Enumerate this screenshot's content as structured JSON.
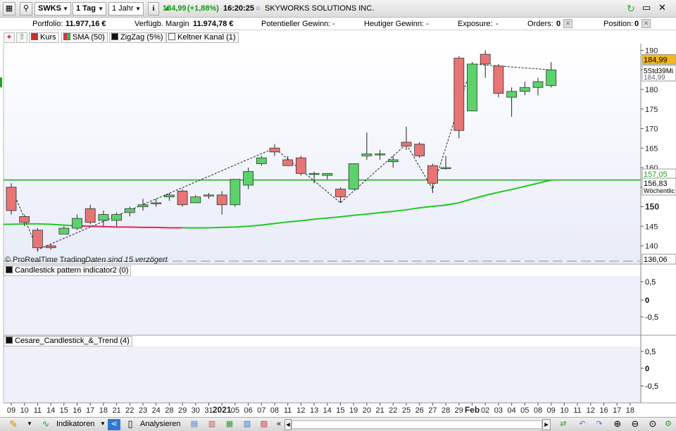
{
  "toolbar": {
    "symbol": "SWKS",
    "interval": "1 Tag",
    "range": "1 Jahr",
    "price": "184,99",
    "change": "(+1,88%)",
    "time": "16:20:25",
    "company": "SKYWORKS SOLUTIONS INC.",
    "info_icon": "info-icon"
  },
  "infobar": {
    "portfolio_label": "Portfolio:",
    "portfolio_value": "11.977,16 €",
    "margin_label": "Verfügb. Margin",
    "margin_value": "11.974,78 €",
    "pot_gain_label": "Potentieller Gewinn:",
    "pot_gain_value": "-",
    "today_gain_label": "Heutiger Gewinn:",
    "today_gain_value": "-",
    "exposure_label": "Exposure:",
    "exposure_value": "-",
    "orders_label": "Orders:",
    "orders_value": "0",
    "position_label": "Position:",
    "position_value": "0"
  },
  "indicators": {
    "kurs": "Kurs",
    "sma": "SMA (50)",
    "zigzag": "ZigZag (5%)",
    "keltner": "Keltner Kanal (1)"
  },
  "chart_labels": {
    "copyright": "© ProRealTime Trading",
    "delay": "Daten sind 15 verzögert",
    "price_tag": "184,99",
    "time_tag": "5Std39Mi",
    "hidden_tag": "184,99",
    "tag_157": "157,05",
    "tag_156": "156,83",
    "tag_weekly": "Wöchentlic",
    "tag_136": "136,06"
  },
  "panels": {
    "panel1_title": "Candlestick pattern indicator2 (0)",
    "panel2_title": "Cesare_Candlestick_&_Trend (4)",
    "p1_ticks": [
      "0,5",
      "0",
      "-0,5"
    ],
    "p2_ticks": [
      "0,5",
      "0",
      "-0,5"
    ]
  },
  "bottombar": {
    "indikatoren": "Indikatoren",
    "analysieren": "Analysieren"
  },
  "colors": {
    "up": "#5bd26a",
    "down": "#e77575",
    "sma_up": "#22c922",
    "sma_down": "#e8245a",
    "hline": "#1fa81f",
    "price_tag": "#f2b81c"
  },
  "chart_data": {
    "type": "candlestick",
    "y_ticks": [
      140,
      145,
      150,
      155,
      160,
      165,
      170,
      175,
      180,
      185,
      190
    ],
    "ylim": [
      136,
      192
    ],
    "x_labels": [
      "09",
      "10",
      "11",
      "14",
      "15",
      "16",
      "17",
      "18",
      "21",
      "22",
      "23",
      "24",
      "28",
      "29",
      "30",
      "31",
      "2021",
      "05",
      "06",
      "07",
      "08",
      "11",
      "12",
      "13",
      "14",
      "15",
      "19",
      "20",
      "21",
      "22",
      "25",
      "26",
      "27",
      "28",
      "29",
      "Feb",
      "02",
      "03",
      "04",
      "05",
      "08",
      "09",
      "10",
      "11",
      "12",
      "16",
      "17",
      "18"
    ],
    "candles": [
      {
        "o": 155,
        "h": 156,
        "l": 148,
        "c": 149
      },
      {
        "o": 147.5,
        "h": 148,
        "l": 145,
        "c": 146
      },
      {
        "o": 144,
        "h": 144.5,
        "l": 138.5,
        "c": 139.5
      },
      {
        "o": 140,
        "h": 140.5,
        "l": 139,
        "c": 139.5
      },
      {
        "o": 143,
        "h": 145,
        "l": 143,
        "c": 144.5
      },
      {
        "o": 144.5,
        "h": 148,
        "l": 144,
        "c": 147
      },
      {
        "o": 149.5,
        "h": 150.5,
        "l": 145.5,
        "c": 146
      },
      {
        "o": 146.5,
        "h": 149,
        "l": 145,
        "c": 148
      },
      {
        "o": 146.5,
        "h": 148.5,
        "l": 145,
        "c": 148
      },
      {
        "o": 148.5,
        "h": 150,
        "l": 147.5,
        "c": 149.5
      },
      {
        "o": 150,
        "h": 152,
        "l": 149,
        "c": 150.5
      },
      {
        "o": 151,
        "h": 152,
        "l": 150,
        "c": 151
      },
      {
        "o": 152.5,
        "h": 153.5,
        "l": 151.5,
        "c": 153
      },
      {
        "o": 154,
        "h": 154.5,
        "l": 150,
        "c": 150.5
      },
      {
        "o": 151,
        "h": 153,
        "l": 151,
        "c": 152.5
      },
      {
        "o": 153,
        "h": 153.5,
        "l": 152,
        "c": 153
      },
      {
        "o": 153,
        "h": 154,
        "l": 148,
        "c": 150.5
      },
      {
        "o": 150.5,
        "h": 157,
        "l": 150,
        "c": 157
      },
      {
        "o": 155.5,
        "h": 160,
        "l": 154.5,
        "c": 159
      },
      {
        "o": 161,
        "h": 163,
        "l": 160.5,
        "c": 162.5
      },
      {
        "o": 165,
        "h": 166,
        "l": 163,
        "c": 164
      },
      {
        "o": 162,
        "h": 163,
        "l": 160.5,
        "c": 160.5
      },
      {
        "o": 162.5,
        "h": 163,
        "l": 158,
        "c": 158.5
      },
      {
        "o": 158.5,
        "h": 159,
        "l": 156,
        "c": 158.5
      },
      {
        "o": 158,
        "h": 158.5,
        "l": 157,
        "c": 158.5
      },
      {
        "o": 154.5,
        "h": 155,
        "l": 151,
        "c": 152.5
      },
      {
        "o": 154.5,
        "h": 161,
        "l": 154.5,
        "c": 161
      },
      {
        "o": 163,
        "h": 169,
        "l": 162,
        "c": 163.5
      },
      {
        "o": 163.5,
        "h": 164.5,
        "l": 162,
        "c": 163.5
      },
      {
        "o": 161.5,
        "h": 163,
        "l": 160,
        "c": 162
      },
      {
        "o": 166.5,
        "h": 170.5,
        "l": 164.5,
        "c": 165.5
      },
      {
        "o": 166,
        "h": 166.5,
        "l": 162.5,
        "c": 163
      },
      {
        "o": 160.5,
        "h": 161,
        "l": 153.5,
        "c": 156
      },
      {
        "o": 160,
        "h": 163,
        "l": 159.5,
        "c": 160
      },
      {
        "o": 188,
        "h": 188.5,
        "l": 167.5,
        "c": 169.5
      },
      {
        "o": 174.5,
        "h": 187,
        "l": 174.5,
        "c": 186.5
      },
      {
        "o": 189,
        "h": 190,
        "l": 183,
        "c": 186.5
      },
      {
        "o": 186,
        "h": 186.5,
        "l": 178,
        "c": 179
      },
      {
        "o": 178,
        "h": 180.5,
        "l": 173,
        "c": 179.5
      },
      {
        "o": 179.5,
        "h": 182,
        "l": 178.5,
        "c": 180.5
      },
      {
        "o": 180.5,
        "h": 183,
        "l": 178.5,
        "c": 182
      },
      {
        "o": 181,
        "h": 187,
        "l": 180.5,
        "c": 185
      }
    ],
    "sma": [
      145.5,
      145.6,
      145.6,
      145.5,
      145.3,
      145.1,
      145.0,
      144.9,
      144.8,
      144.8,
      144.7,
      144.7,
      144.6,
      144.6,
      144.6,
      144.6,
      144.7,
      144.8,
      145.0,
      145.3,
      145.7,
      146.1,
      146.4,
      146.8,
      147.1,
      147.4,
      147.8,
      148.1,
      148.5,
      148.8,
      149.2,
      149.7,
      150.1,
      150.4,
      151.0,
      152.0,
      152.9,
      153.7,
      154.4,
      155.2,
      156.0,
      156.8
    ],
    "zigzag": [
      [
        0,
        155
      ],
      [
        2,
        139
      ],
      [
        20,
        165
      ],
      [
        25,
        151
      ],
      [
        30,
        166
      ],
      [
        32,
        154.5
      ],
      [
        35,
        186.5
      ],
      [
        41,
        185
      ]
    ],
    "hline": 156.83,
    "dashed_line": 136.06
  }
}
